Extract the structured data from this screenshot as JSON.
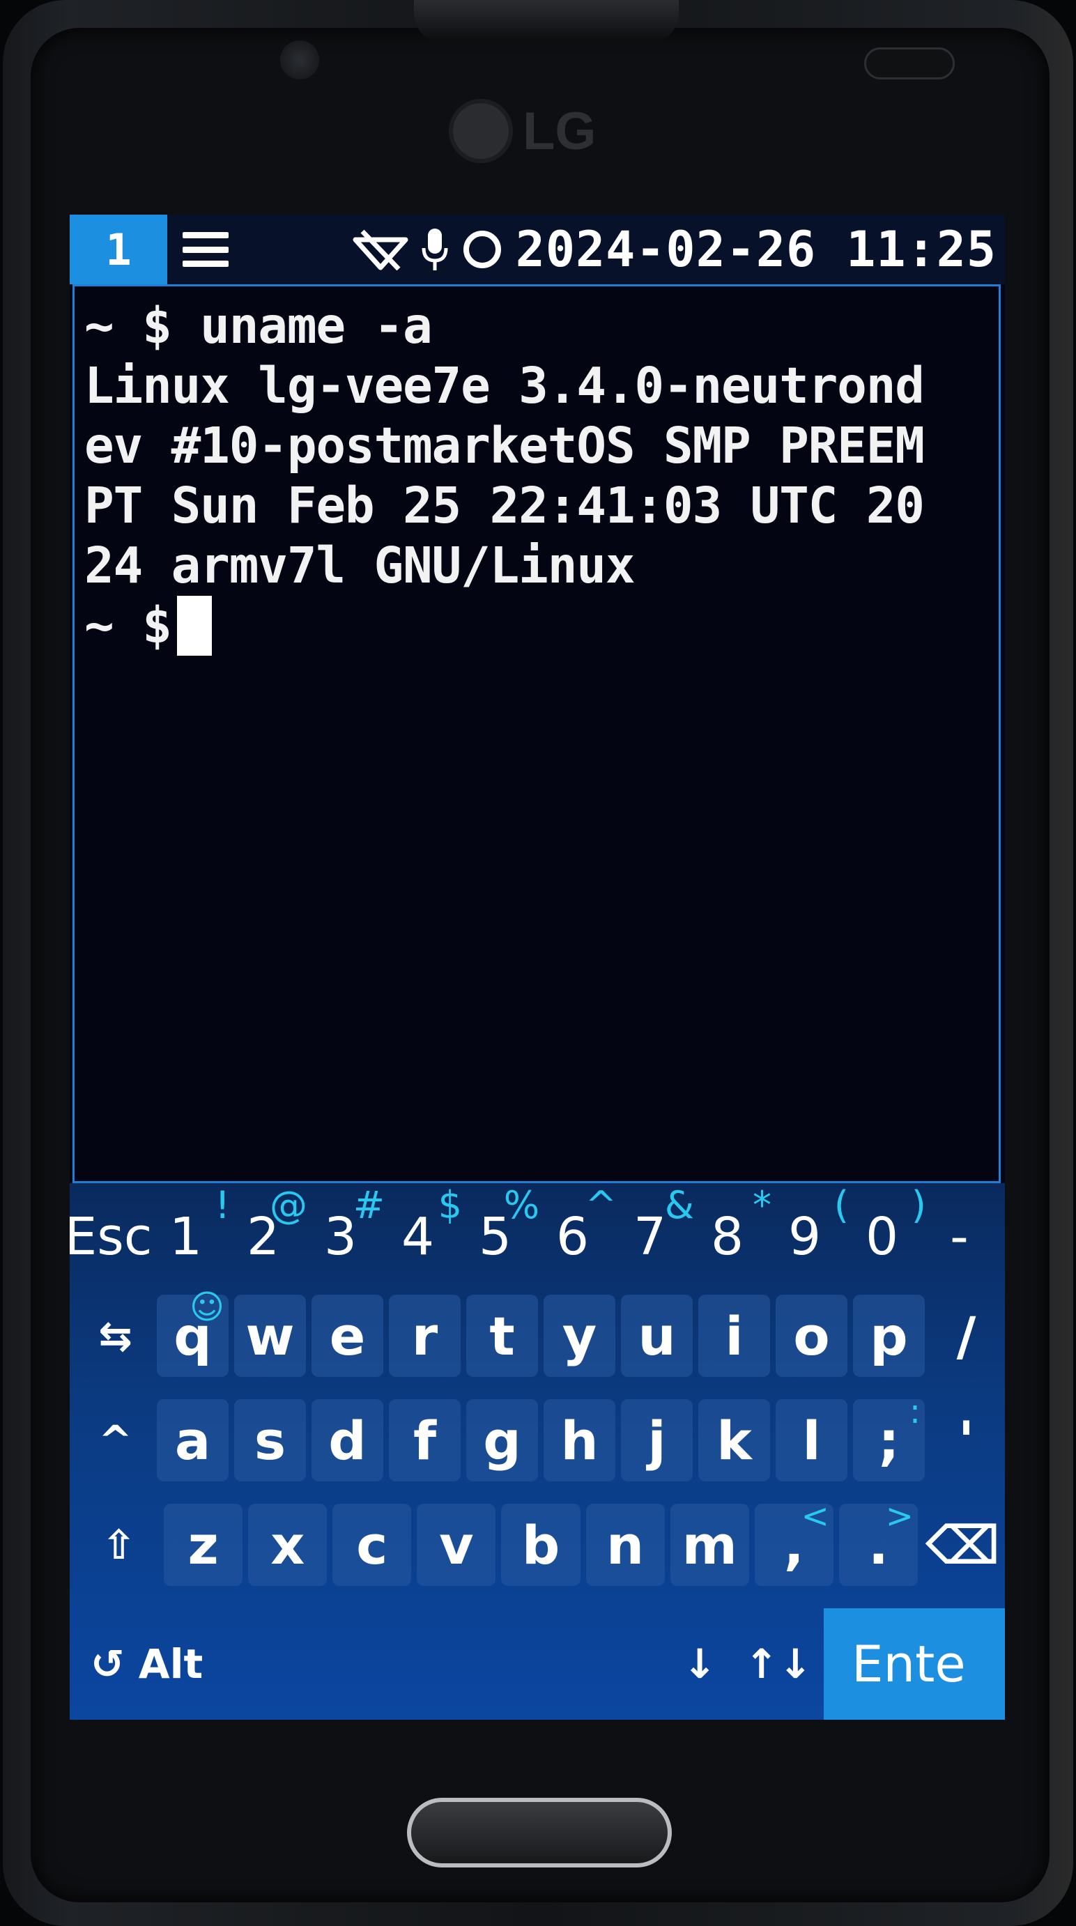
{
  "device": {
    "brand": "LG"
  },
  "status_bar": {
    "workspace": "1",
    "icons": [
      "menu-icon",
      "no-network-icon",
      "microphone-icon",
      "circle-icon"
    ],
    "datetime": "2024-02-26 11:25",
    "accent_color": "#1d8fe0"
  },
  "terminal": {
    "lines": [
      "~ $ uname -a",
      "Linux lg-vee7e 3.4.0-neutrond",
      "ev #10-postmarketOS SMP PREEM",
      "PT Sun Feb 25 22:41:03 UTC 20",
      "24 armv7l GNU/Linux"
    ],
    "prompt": "~ $"
  },
  "keyboard": {
    "number_row": [
      {
        "main": "Esc",
        "sub": ""
      },
      {
        "main": "1",
        "sub": "!"
      },
      {
        "main": "2",
        "sub": "@"
      },
      {
        "main": "3",
        "sub": "#"
      },
      {
        "main": "4",
        "sub": "$"
      },
      {
        "main": "5",
        "sub": "%"
      },
      {
        "main": "6",
        "sub": "^"
      },
      {
        "main": "7",
        "sub": "&"
      },
      {
        "main": "8",
        "sub": "*"
      },
      {
        "main": "9",
        "sub": "("
      },
      {
        "main": "0",
        "sub": ")"
      },
      {
        "main": "-",
        "sub": ""
      }
    ],
    "row1": [
      {
        "main": "⇆",
        "sub": ""
      },
      {
        "main": "q",
        "sub": "☺"
      },
      {
        "main": "w",
        "sub": ""
      },
      {
        "main": "e",
        "sub": ""
      },
      {
        "main": "r",
        "sub": ""
      },
      {
        "main": "t",
        "sub": ""
      },
      {
        "main": "y",
        "sub": ""
      },
      {
        "main": "u",
        "sub": ""
      },
      {
        "main": "i",
        "sub": ""
      },
      {
        "main": "o",
        "sub": ""
      },
      {
        "main": "p",
        "sub": ""
      },
      {
        "main": "/",
        "sub": ""
      }
    ],
    "row2": [
      {
        "main": "^",
        "sub": ""
      },
      {
        "main": "a",
        "sub": ""
      },
      {
        "main": "s",
        "sub": ""
      },
      {
        "main": "d",
        "sub": ""
      },
      {
        "main": "f",
        "sub": ""
      },
      {
        "main": "g",
        "sub": ""
      },
      {
        "main": "h",
        "sub": ""
      },
      {
        "main": "j",
        "sub": ""
      },
      {
        "main": "k",
        "sub": ""
      },
      {
        "main": "l",
        "sub": ""
      },
      {
        "main": ";",
        "sub": ":"
      },
      {
        "main": "'",
        "sub": ""
      }
    ],
    "row3": [
      {
        "main": "⇧",
        "sub": ""
      },
      {
        "main": "z",
        "sub": ""
      },
      {
        "main": "x",
        "sub": ""
      },
      {
        "main": "c",
        "sub": ""
      },
      {
        "main": "v",
        "sub": ""
      },
      {
        "main": "b",
        "sub": ""
      },
      {
        "main": "n",
        "sub": ""
      },
      {
        "main": "m",
        "sub": ""
      },
      {
        "main": ",",
        "sub": "<"
      },
      {
        "main": ".",
        "sub": ">"
      },
      {
        "main": "⌫",
        "sub": ""
      }
    ],
    "bottom_row": {
      "alt_label": "↺ Alt",
      "down_label": "↓",
      "updown_label": "↑↓",
      "enter_label": "Ente"
    },
    "sub_color": "#29c9ef"
  }
}
